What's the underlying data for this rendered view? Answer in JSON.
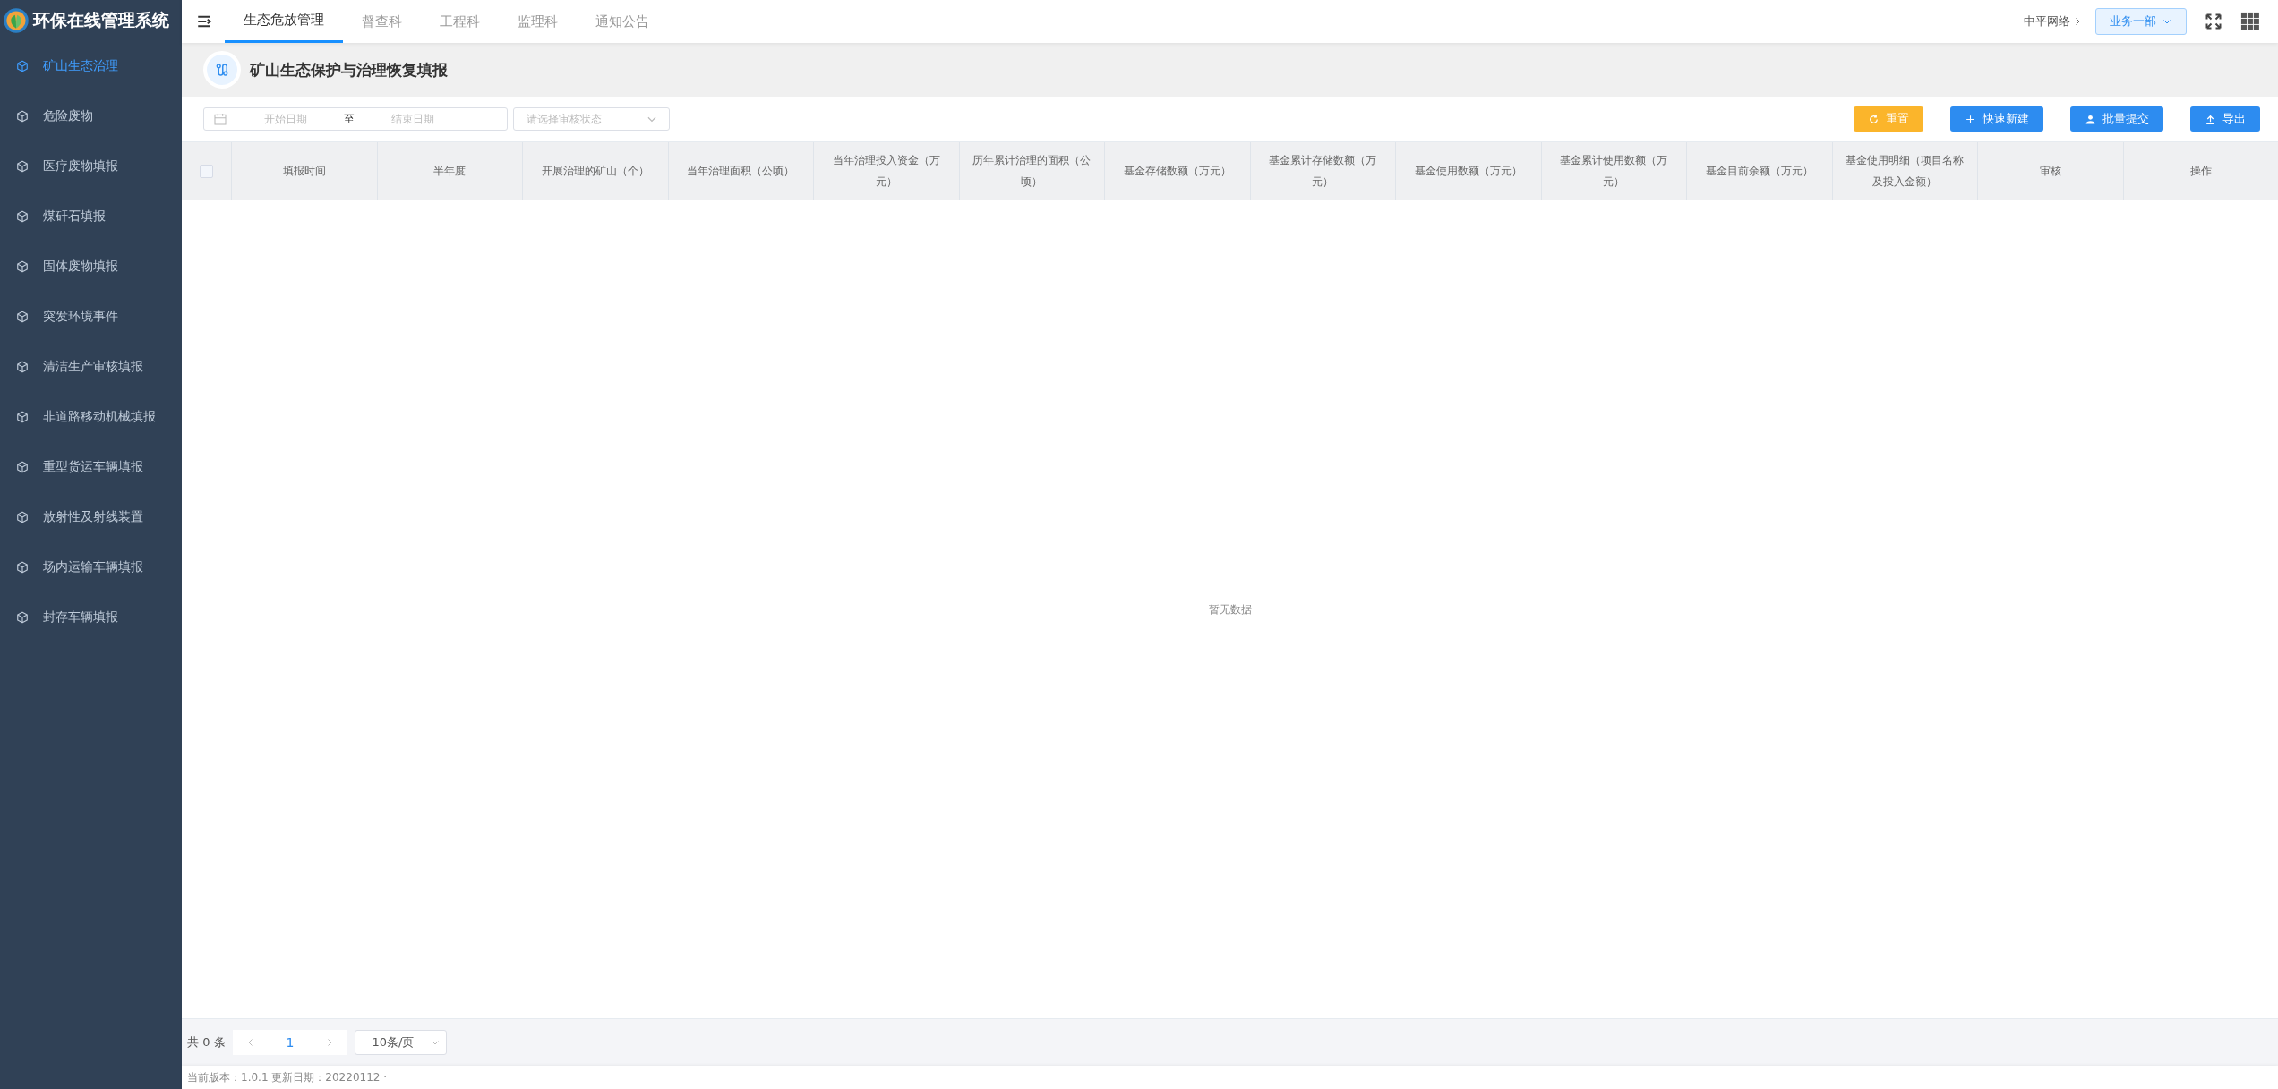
{
  "app": {
    "title": "环保在线管理系统"
  },
  "top_tabs": [
    {
      "label": "生态危放管理",
      "selected": true
    },
    {
      "label": "督查科",
      "selected": false
    },
    {
      "label": "工程科",
      "selected": false
    },
    {
      "label": "监理科",
      "selected": false
    },
    {
      "label": "通知公告",
      "selected": false
    }
  ],
  "header_right": {
    "org": "中平网络",
    "department": "业务一部"
  },
  "sidebar": {
    "items": [
      {
        "label": "矿山生态治理",
        "selected": true
      },
      {
        "label": "危险废物",
        "selected": false
      },
      {
        "label": "医疗废物填报",
        "selected": false
      },
      {
        "label": "煤矸石填报",
        "selected": false
      },
      {
        "label": "固体废物填报",
        "selected": false
      },
      {
        "label": "突发环境事件",
        "selected": false
      },
      {
        "label": "清洁生产审核填报",
        "selected": false
      },
      {
        "label": "非道路移动机械填报",
        "selected": false
      },
      {
        "label": "重型货运车辆填报",
        "selected": false
      },
      {
        "label": "放射性及射线装置",
        "selected": false
      },
      {
        "label": "场内运输车辆填报",
        "selected": false
      },
      {
        "label": "封存车辆填报",
        "selected": false
      }
    ]
  },
  "page_title": "矿山生态保护与治理恢复填报",
  "filters": {
    "start_date": {
      "placeholder": "开始日期"
    },
    "separator": "至",
    "end_date": {
      "placeholder": "结束日期"
    },
    "status": {
      "placeholder": "请选择审核状态"
    }
  },
  "actions": [
    {
      "label": "重置",
      "kind": "reset"
    },
    {
      "label": "快速新建",
      "kind": "add"
    },
    {
      "label": "批量提交",
      "kind": "submit"
    },
    {
      "label": "导出",
      "kind": "export"
    }
  ],
  "table": {
    "select_all": {
      "checked": false
    },
    "columns": [
      "填报时间",
      "半年度",
      "开展治理的矿山（个）",
      "当年治理面积（公顷）",
      "当年治理投入资金（万元）",
      "历年累计治理的面积（公顷）",
      "基金存储数额（万元）",
      "基金累计存储数额（万元）",
      "基金使用数额（万元）",
      "基金累计使用数额（万元）",
      "基金目前余额（万元）",
      "基金使用明细（项目名称及投入金额）",
      "审核",
      "操作"
    ],
    "empty_text": "暂无数据"
  },
  "pagination": {
    "total": "共 0 条",
    "current_page": "1",
    "page_size": "10条/页"
  },
  "footer": "当前版本：1.0.1 更新日期：20220112 ·"
}
